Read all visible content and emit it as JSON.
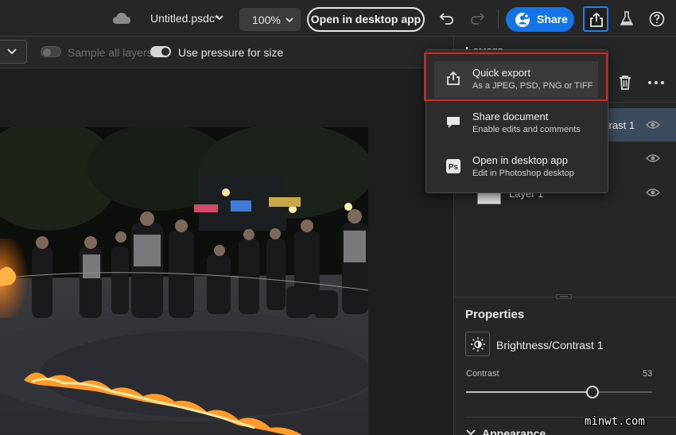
{
  "header": {
    "doc_title": "Untitled.psdc*",
    "zoom": "100%",
    "open_desktop_label": "Open in desktop app",
    "share_label": "Share"
  },
  "options_bar": {
    "sample_all_layers": "Sample all layers",
    "use_pressure": "Use pressure for size"
  },
  "export_menu": {
    "items": [
      {
        "title": "Quick export",
        "subtitle": "As a JPEG, PSD, PNG or TIFF",
        "icon": "export-icon"
      },
      {
        "title": "Share document",
        "subtitle": "Enable edits and comments",
        "icon": "comment-icon"
      },
      {
        "title": "Open in desktop app",
        "subtitle": "Edit in Photoshop desktop",
        "icon": "photoshop-icon"
      }
    ]
  },
  "layers": {
    "title": "Layers",
    "rows": [
      {
        "name": "trast 1",
        "selected": true
      },
      {
        "name": "",
        "selected": false
      },
      {
        "name": "Layer 1",
        "selected": false
      }
    ]
  },
  "properties": {
    "title": "Properties",
    "adjustment_name": "Brightness/Contrast 1",
    "contrast_label": "Contrast",
    "contrast_value": "53",
    "contrast_fraction": 0.68,
    "appearance_label": "Appearance"
  },
  "watermark": "minwt.com",
  "colors": {
    "accent": "#1473e6",
    "highlight": "#e02020",
    "selected_layer": "#3b4a5c"
  }
}
